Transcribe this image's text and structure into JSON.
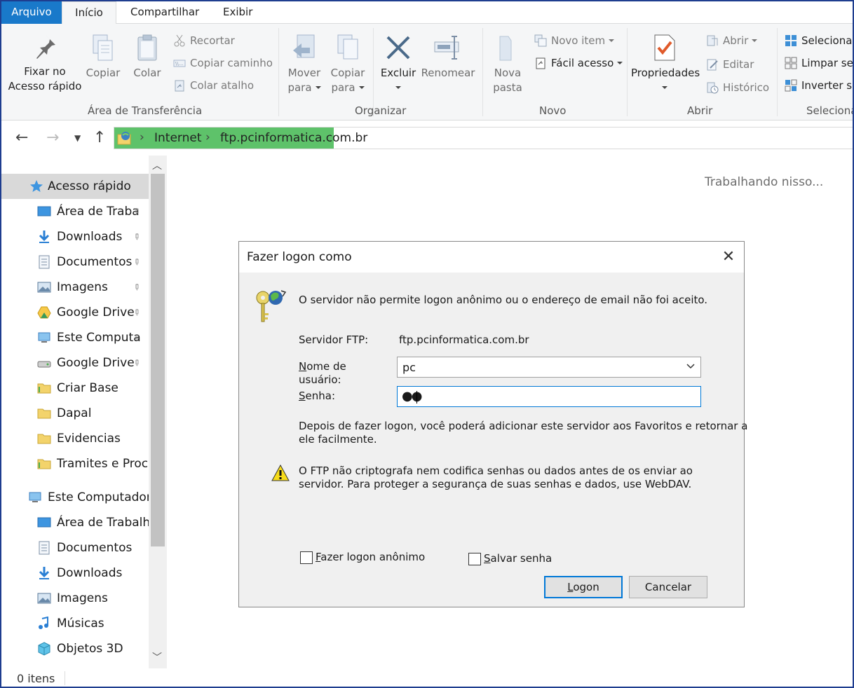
{
  "ribbon_tabs": [
    "Arquivo",
    "Início",
    "Compartilhar",
    "Exibir"
  ],
  "clipboard": {
    "pin_label_1": "Fixar no",
    "pin_label_2": "Acesso rápido",
    "copy": "Copiar",
    "paste": "Colar",
    "cut": "Recortar",
    "copy_path": "Copiar caminho",
    "paste_shortcut": "Colar atalho",
    "group": "Área de Transferência"
  },
  "organize": {
    "move_1": "Mover",
    "move_2": "para",
    "copy_1": "Copiar",
    "copy_2": "para",
    "delete": "Excluir",
    "rename": "Renomear",
    "group": "Organizar"
  },
  "new": {
    "folder_1": "Nova",
    "folder_2": "pasta",
    "new_item": "Novo item",
    "easy_access": "Fácil acesso",
    "group": "Novo"
  },
  "open": {
    "properties": "Propriedades",
    "open": "Abrir",
    "edit": "Editar",
    "history": "Histórico",
    "group": "Abrir"
  },
  "select": {
    "select_all": "Selecionar",
    "select_none": "Limpar sel",
    "invert": "Inverter se",
    "group": "Selecionar"
  },
  "address": {
    "segment1": "Internet",
    "segment2": "ftp.pcinformatica.com.br"
  },
  "sidebar": {
    "quick_access": "Acesso rápido",
    "quick_items": [
      "Área de Traba",
      "Downloads",
      "Documentos",
      "Imagens",
      "Google Drive",
      "Este Computa",
      "Google Drive",
      "Criar Base",
      "Dapal",
      "Evidencias",
      "Tramites e Proce"
    ],
    "this_pc": "Este Computador",
    "pc_items": [
      "Área de Trabalho",
      "Documentos",
      "Downloads",
      "Imagens",
      "Músicas",
      "Objetos 3D"
    ]
  },
  "main": {
    "working": "Trabalhando nisso..."
  },
  "status": {
    "items": "0 itens"
  },
  "dialog": {
    "title": "Fazer logon como",
    "message": "O servidor não permite logon anônimo ou o endereço de email não foi aceito.",
    "server_label": "Servidor FTP:",
    "server_value": "ftp.pcinformatica.com.br",
    "username_label_1": "ome de",
    "username_label_2": "usuário:",
    "username_value": "pc",
    "password_label": "enha:",
    "password_value": "●●",
    "info_1": "Depois de fazer logon, você poderá adicionar este servidor aos Favoritos e retornar a",
    "info_2": "ele facilmente.",
    "warning_1": "O FTP não criptografa nem codifica senhas ou dados antes de os enviar ao",
    "warning_2": "servidor. Para proteger a segurança de suas senhas e dados, use WebDAV.",
    "anon_label": "azer logon anônimo",
    "save_label": "alvar senha",
    "logon": "ogon",
    "cancel": "Cancelar"
  }
}
